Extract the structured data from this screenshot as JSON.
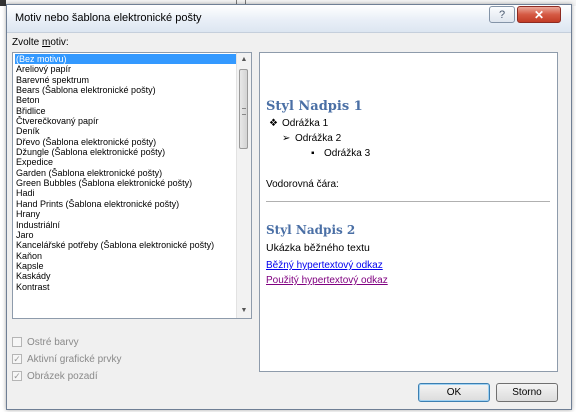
{
  "window": {
    "title": "Motiv nebo šablona elektronické pošty",
    "help_icon": "?",
    "close_icon": "✕"
  },
  "theme_list": {
    "label_prefix": "Zvolte ",
    "label_accel": "m",
    "label_suffix": "otiv:",
    "selected_index": 0,
    "items": [
      "(Bez motivu)",
      "Areliový papír",
      "Barevné spektrum",
      "Bears (Šablona elektronické pošty)",
      "Beton",
      "Břidlice",
      "Čtverečkovaný papír",
      "Deník",
      "Dřevo (Šablona elektronické pošty)",
      "Džungle (Šablona elektronické pošty)",
      "Expedice",
      "Garden (Šablona elektronické pošty)",
      "Green Bubbles (Šablona elektronické pošty)",
      "Hadi",
      "Hand Prints (Šablona elektronické pošty)",
      "Hrany",
      "Industriální",
      "Jaro",
      "Kancelářské potřeby (Šablona elektronické pošty)",
      "Kaňon",
      "Kapsle",
      "Kaskády",
      "Kontrast"
    ]
  },
  "options": {
    "vivid_colors": {
      "label": "Ostré barvy",
      "checked": false
    },
    "active_graphics": {
      "label": "Aktivní grafické prvky",
      "checked": true
    },
    "background_image": {
      "label": "Obrázek pozadí",
      "checked": true
    }
  },
  "preview": {
    "heading1": "Styl Nadpis 1",
    "bullet1": "Odrážka 1",
    "bullet2": "Odrážka 2",
    "bullet3": "Odrážka 3",
    "hr_label": "Vodorovná čára:",
    "heading2": "Styl Nadpis 2",
    "body_text": "Ukázka běžného textu",
    "link": "Běžný hypertextový odkaz",
    "visited_link": "Použitý hypertextový odkaz"
  },
  "buttons": {
    "ok": "OK",
    "cancel": "Storno"
  },
  "colors": {
    "heading": "#4a6fa5",
    "link": "#0000ee",
    "visited": "#800080",
    "selection": "#3399ff"
  }
}
